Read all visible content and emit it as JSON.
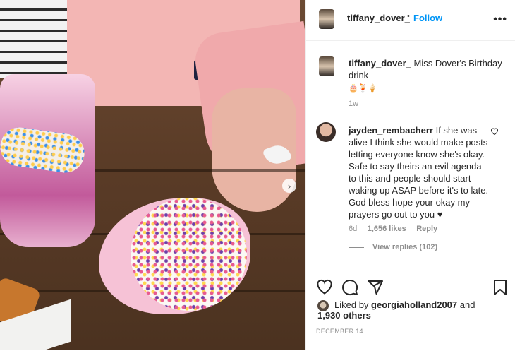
{
  "post": {
    "author": "tiffany_dover_",
    "separator": "•",
    "follow_label": "Follow",
    "more_label": "•••"
  },
  "caption": {
    "username": "tiffany_dover_",
    "text": "Miss Dover's Birthday drink",
    "emoji": "🎂🍹🍦",
    "time": "1w"
  },
  "comments": [
    {
      "username": "jayden_rembacherr",
      "text": "If she was alive I think she would make posts letting everyone know she's okay. Safe to say theirs an evil agenda to this and people should start waking up ASAP before it's to late. God bless hope your okay my prayers go out to you ♥",
      "time": "6d",
      "likes": "1,656 likes",
      "reply_label": "Reply",
      "view_replies": "View replies (102)"
    }
  ],
  "likes": {
    "prefix": "Liked by",
    "user": "georgiaholland2007",
    "connector": "and",
    "count": "1,930 others"
  },
  "date": "DECEMBER 14",
  "icons": [
    "heart-icon",
    "comment-icon",
    "share-icon",
    "bookmark-icon",
    "chevron-right-icon",
    "more-icon"
  ],
  "colors": {
    "follow": "#0095f6",
    "meta": "#8e8e8e",
    "text": "#262626",
    "border": "#efefef"
  }
}
